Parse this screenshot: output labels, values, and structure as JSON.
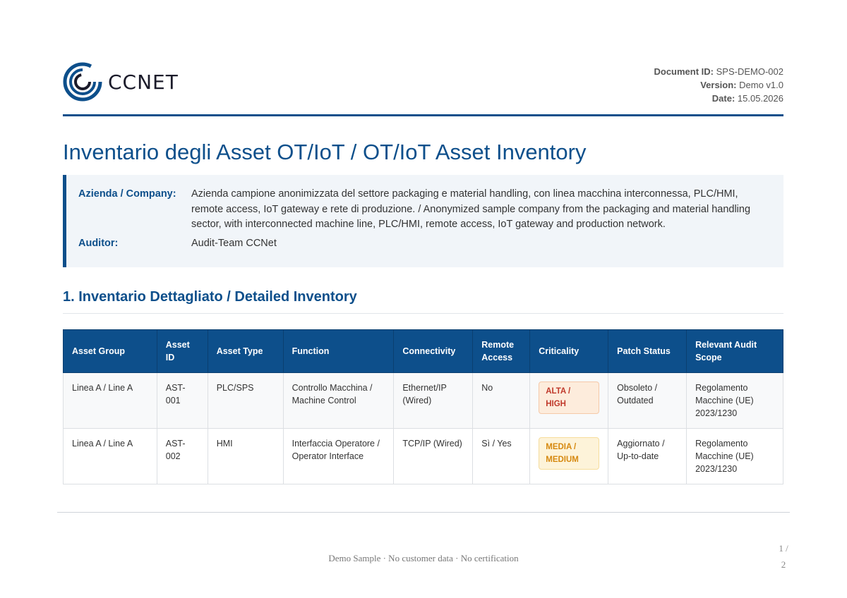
{
  "header": {
    "logo_text": "CCNET",
    "document_id_label": "Document ID:",
    "document_id": "SPS-DEMO-002",
    "version_label": "Version:",
    "version": "Demo v1.0",
    "date_label": "Date:",
    "date": "15.05.2026"
  },
  "title": "Inventario degli Asset OT/IoT / OT/IoT Asset Inventory",
  "info": {
    "company_label": "Azienda / Company:",
    "company_value": "Azienda campione anonimizzata del settore packaging e material handling, con linea macchina interconnessa, PLC/HMI, remote access, IoT gateway e rete di produzione. / Anonymized sample company from the packaging and material handling sector, with interconnected machine line, PLC/HMI, remote access, IoT gateway and production network.",
    "auditor_label": "Auditor:",
    "auditor_value": "Audit-Team CCNet"
  },
  "section": {
    "title": "1. Inventario Dettagliato / Detailed Inventory"
  },
  "table": {
    "headers": [
      "Asset Group",
      "Asset ID",
      "Asset Type",
      "Function",
      "Connectivity",
      "Remote Access",
      "Criticality",
      "Patch Status",
      "Relevant Audit Scope"
    ],
    "rows": [
      [
        "Linea A / Line A",
        "AST-001",
        "PLC/SPS",
        "Controllo Macchina / Machine Control",
        "Ethernet/IP (Wired)",
        "No",
        "ALTA / HIGH",
        "Obsoleto / Outdated",
        "Regolamento Macchine (UE) 2023/1230"
      ],
      [
        "Linea A / Line A",
        "AST-002",
        "HMI",
        "Interfaccia Operatore / Operator Interface",
        "TCP/IP (Wired)",
        "Sì / Yes",
        "MEDIA / MEDIUM",
        "Aggiornato / Up-to-date",
        "Regolamento Macchine (UE) 2023/1230"
      ]
    ]
  },
  "footer": {
    "text": "Demo Sample · No customer data · No certification",
    "page_current": "1 /",
    "page_total": "2"
  },
  "colors": {
    "brand_blue": "#0d4f8b",
    "high": "#c0392b",
    "medium": "#d68910"
  }
}
